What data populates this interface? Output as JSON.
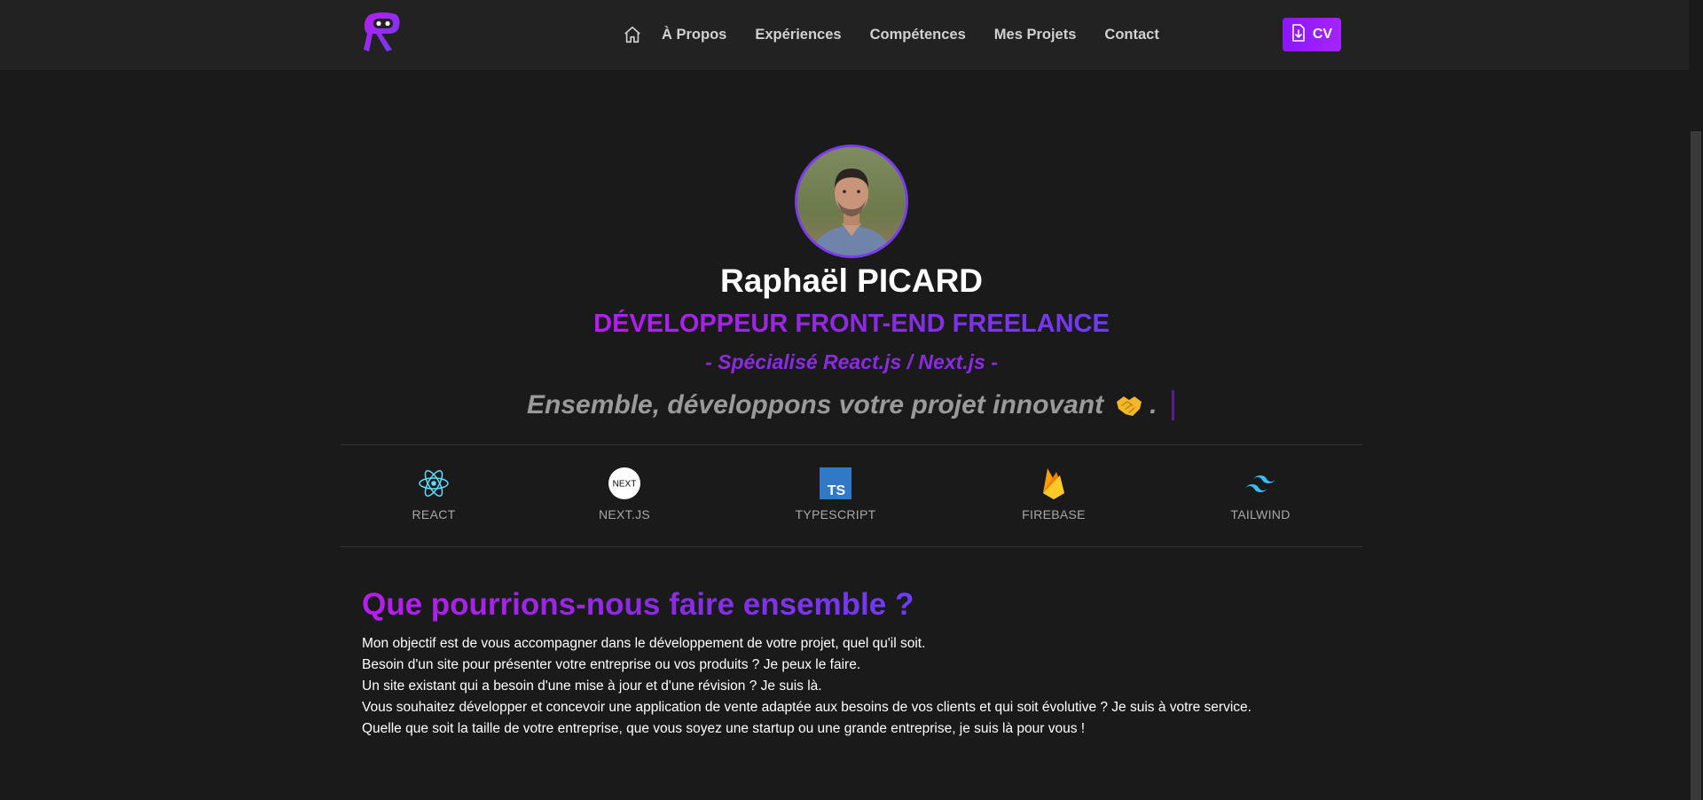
{
  "header": {
    "nav": [
      "À Propos",
      "Expériences",
      "Compétences",
      "Mes Projets",
      "Contact"
    ],
    "cv_label": "CV"
  },
  "hero": {
    "name": "Raphaël PICARD",
    "title": "DÉVELOPPEUR FRONT-END FREELANCE",
    "subtitle": "- Spécialisé React.js / Next.js -",
    "tagline": "Ensemble, développons votre projet innovant",
    "tagline_end": "."
  },
  "techs": [
    {
      "label": "REACT",
      "icon": "react-icon"
    },
    {
      "label": "NEXT.JS",
      "icon": "nextjs-icon"
    },
    {
      "label": "TYPESCRIPT",
      "icon": "typescript-icon"
    },
    {
      "label": "FIREBASE",
      "icon": "firebase-icon"
    },
    {
      "label": "TAILWIND",
      "icon": "tailwind-icon"
    }
  ],
  "about": {
    "title": "Que pourrions-nous faire ensemble ?",
    "lines": [
      "Mon objectif est de vous accompagner dans le développement de votre projet, quel qu'il soit.",
      "Besoin d'un site pour présenter votre entreprise ou vos produits ? Je peux le faire.",
      "Un site existant qui a besoin d'une mise à jour et d'une révision ? Je suis là.",
      "Vous souhaitez développer et concevoir une application de vente adaptée aux besoins de vos clients et qui soit évolutive ? Je suis à votre service.",
      "Quelle que soit la taille de votre entreprise, que vous soyez une startup ou une grande entreprise, je suis là pour vous !"
    ]
  },
  "colors": {
    "accent_purple": "#8a2be2",
    "accent_magenta": "#b81cf0",
    "background": "#1a1a1a",
    "header_bg": "#222222"
  }
}
